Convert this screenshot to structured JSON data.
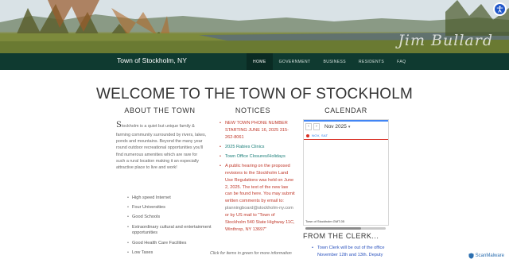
{
  "banner": {
    "signature": "Jim Bullard"
  },
  "header": {
    "site_title": "Town of Stockholm, NY"
  },
  "nav": [
    {
      "label": "HOME"
    },
    {
      "label": "GOVERNMENT"
    },
    {
      "label": "BUSINESS"
    },
    {
      "label": "RESIDENTS"
    },
    {
      "label": "FAQ"
    }
  ],
  "main": {
    "welcome": "WELCOME TO THE TOWN OF STOCKHOLM",
    "about": {
      "heading": "ABOUT THE TOWN",
      "drop_cap": "S",
      "intro": "tockholm is a quiet but unique family & farming community surrounded by rivers, lakes, ponds and mountains. Beyond the many year round outdoor recreational opportunities you'll find numerous amenities which are rare for such a rural location making it an especially attractive place to live and work!",
      "features": [
        "High speed Internet",
        "Four Universities",
        "Good Schools",
        "Extraordinary cultural and entertainment opportunities",
        "Good Health Care Facilities",
        "Low Taxes"
      ]
    },
    "notices": {
      "heading": "NOTICES",
      "items": [
        {
          "text": "NEW TOWN PHONE NUMBER STARTING JUNE 16, 2025 315-262-8061"
        },
        {
          "text": "2025 Rabies Clinics"
        },
        {
          "text": "Town Office Closures/Holidays"
        },
        {
          "text_a": "A public hearing on the proposed revisions to the Stockholm Land Use Regulations was held on June 2, 2025. The text of the new law can be found ",
          "link": "here",
          "text_b": ". You may submit written comments by email to: ",
          "email": "planningboard@stockholm-ny.com",
          "text_c": " or by US mail to \"Town of Stockholm 540 State Highway 11C, Winthrop, NY 13697\""
        }
      ],
      "footer": "Click for items in green for more information"
    },
    "calendar": {
      "heading": "CALENDAR",
      "prev": "‹",
      "next": "›",
      "month": "Nov 2025",
      "dropdown": "▾",
      "day_label": "NOV, SAT",
      "footer": "Town of Stockholm  GMT-05"
    },
    "clerk": {
      "heading": "FROM THE CLERK...",
      "text": "Town Clerk will be out of the office November 12th and 13th. Deputy"
    }
  },
  "badge": {
    "label": "ScanMalware"
  }
}
